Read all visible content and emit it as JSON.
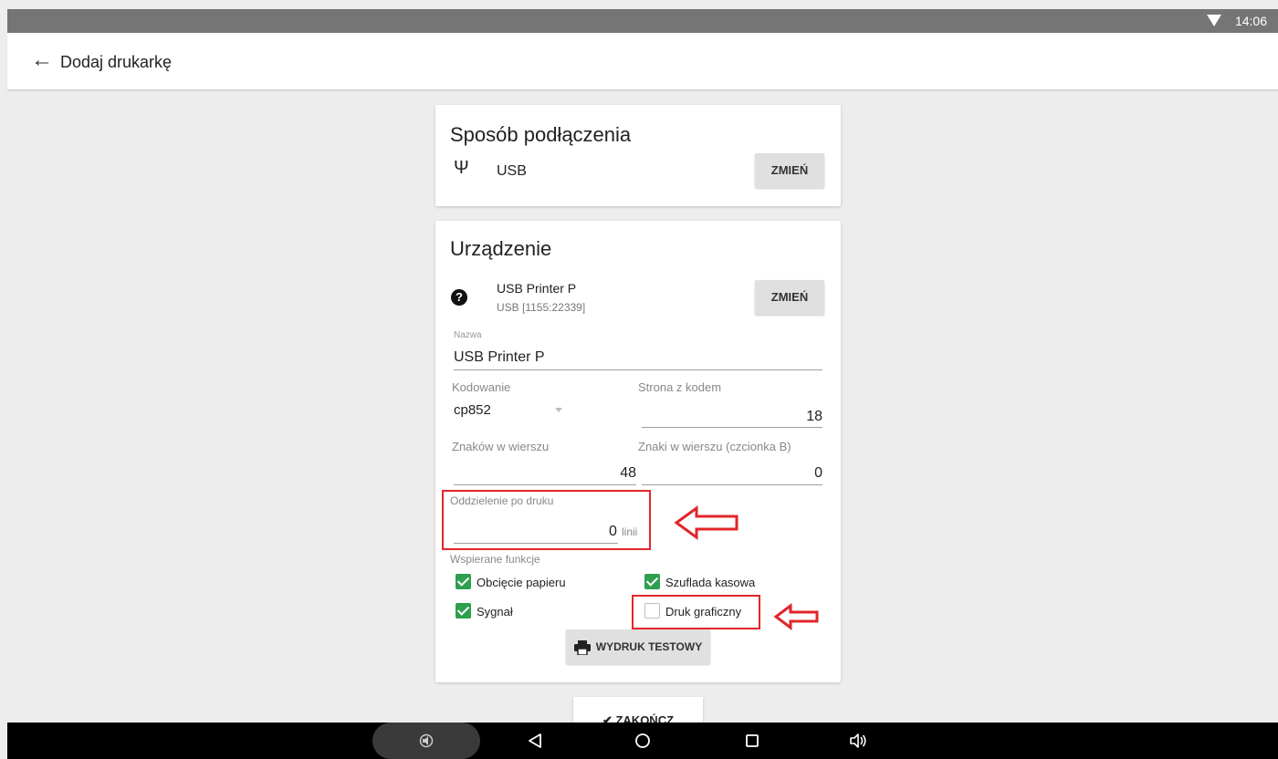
{
  "status_bar": {
    "time": "14:06"
  },
  "app_bar": {
    "back_icon": "←",
    "title": "Dodaj drukarkę"
  },
  "connection_card": {
    "title": "Sposób podłączenia",
    "usb_icon": "Ψ",
    "type": "USB",
    "change_label": "ZMIEŃ"
  },
  "device_card": {
    "title": "Urządzenie",
    "help_icon": "?",
    "device_name": "USB Printer P",
    "device_id": "USB [1155:22339]",
    "change_label": "ZMIEŃ",
    "name_label": "Nazwa",
    "name_value": "USB Printer P",
    "encoding_label": "Kodowanie",
    "encoding_value": "cp852",
    "codepage_label": "Strona z kodem",
    "codepage_value": "18",
    "chars_label": "Znaków w wierszu",
    "chars_value": "48",
    "chars_b_label": "Znaki w wierszu (czcionka B)",
    "chars_b_value": "0",
    "separation_label": "Oddzielenie po druku",
    "separation_value": "0",
    "separation_unit": "linii",
    "features_label": "Wspierane funkcje",
    "features": [
      {
        "label": "Obcięcie papieru",
        "checked": true
      },
      {
        "label": "Szuflada kasowa",
        "checked": true
      },
      {
        "label": "Sygnał",
        "checked": true
      },
      {
        "label": "Druk graficzny",
        "checked": false
      }
    ],
    "test_print_label": "WYDRUK TESTOWY"
  },
  "finish_label": "✔ ZAKOŃCZ",
  "colors": {
    "accent_red": "#e0262a",
    "check_green": "#2e9e4f"
  }
}
